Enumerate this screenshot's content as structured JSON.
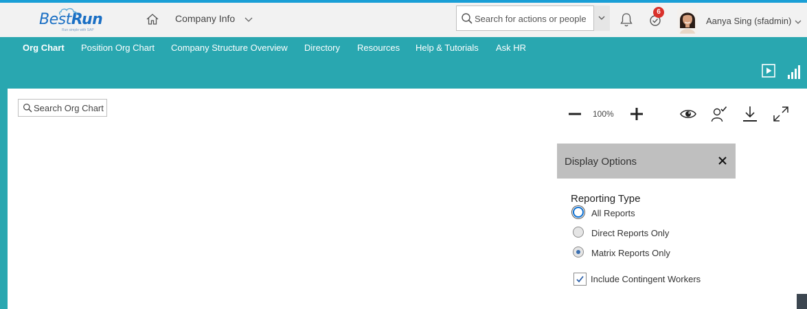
{
  "header": {
    "logo_text_1": "Best",
    "logo_text_2": "Run",
    "logo_tagline": "Run simple with SAP",
    "module_label": "Company Info",
    "search_placeholder": "Search for actions or people",
    "notification_count": "6",
    "user_name": "Aanya Sing (sfadmin)"
  },
  "nav": {
    "items": [
      {
        "label": "Org Chart",
        "active": true
      },
      {
        "label": "Position Org Chart"
      },
      {
        "label": "Company Structure Overview"
      },
      {
        "label": "Directory"
      },
      {
        "label": "Resources"
      },
      {
        "label": "Help & Tutorials"
      },
      {
        "label": "Ask HR"
      }
    ]
  },
  "main": {
    "search_placeholder": "Search Org Chart",
    "zoom_label": "100%"
  },
  "display_options": {
    "title": "Display Options",
    "reporting_type_label": "Reporting Type",
    "options": [
      {
        "label": "All Reports"
      },
      {
        "label": "Direct Reports Only"
      },
      {
        "label": "Matrix Reports Only",
        "selected": true
      }
    ],
    "contingent_label": "Include Contingent Workers",
    "contingent_checked": true
  },
  "colors": {
    "brand_teal": "#29a7b0",
    "top_accent": "#1a9fd6",
    "badge": "#d9312b"
  }
}
